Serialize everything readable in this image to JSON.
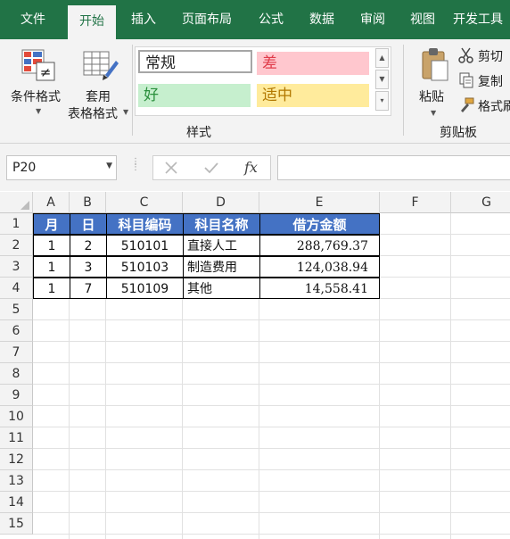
{
  "ribbon_tabs": [
    {
      "label": "文件",
      "active": false
    },
    {
      "label": "开始",
      "active": true
    },
    {
      "label": "插入",
      "active": false
    },
    {
      "label": "页面布局",
      "active": false
    },
    {
      "label": "公式",
      "active": false
    },
    {
      "label": "数据",
      "active": false
    },
    {
      "label": "审阅",
      "active": false
    },
    {
      "label": "视图",
      "active": false
    },
    {
      "label": "开发工具",
      "active": false
    }
  ],
  "ribbon": {
    "conditional_format": {
      "label": "条件格式"
    },
    "table_format": {
      "label_line1": "套用",
      "label_line2": "表格格式"
    },
    "styles": {
      "normal": "常规",
      "bad": "差",
      "good": "好",
      "neutral": "适中",
      "group_label": "样式"
    },
    "clipboard": {
      "paste": "粘贴",
      "cut": "剪切",
      "copy": "复制",
      "format_painter": "格式刷",
      "group_label": "剪贴板"
    }
  },
  "formula_bar": {
    "name_box": "P20",
    "fx": "fx",
    "formula": ""
  },
  "columns": [
    "A",
    "B",
    "C",
    "D",
    "E",
    "F",
    "G"
  ],
  "rows": [
    "1",
    "2",
    "3",
    "4",
    "5",
    "6",
    "7",
    "8",
    "9",
    "10",
    "11",
    "12",
    "13",
    "14",
    "15"
  ],
  "table": {
    "headers": [
      "月",
      "日",
      "科目编码",
      "科目名称",
      "借方金额"
    ],
    "rows": [
      [
        "1",
        "2",
        "510101",
        "直接人工",
        "288,769.37"
      ],
      [
        "1",
        "3",
        "510103",
        "制造费用",
        "124,038.94"
      ],
      [
        "1",
        "7",
        "510109",
        "其他",
        "14,558.41"
      ]
    ]
  },
  "colors": {
    "ribbon_green": "#217346",
    "table_header_blue": "#4472c4",
    "style_bad_bg": "#ffc7ce",
    "style_good_bg": "#c6efce",
    "style_neutral_bg": "#ffeb9c"
  }
}
